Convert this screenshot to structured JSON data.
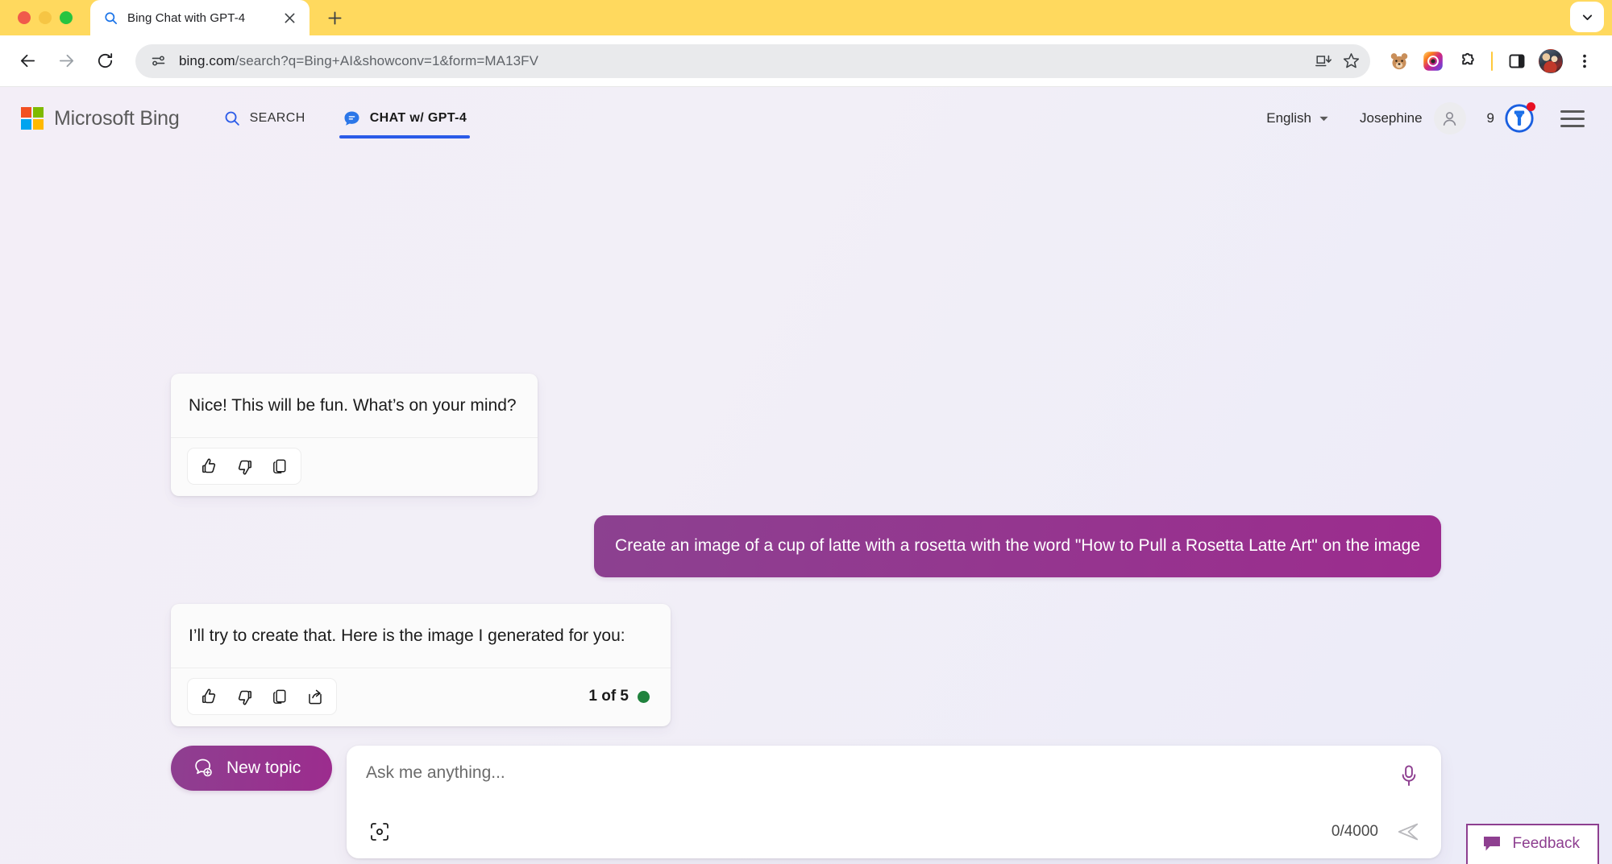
{
  "browser": {
    "window_controls": [
      "close",
      "minimize",
      "maximize"
    ],
    "tab": {
      "title": "Bing Chat with GPT-4",
      "favicon": "search-icon",
      "close_label": "×"
    },
    "new_tab_label": "+",
    "tab_list_chevron": "chevron-down-icon",
    "toolbar": {
      "back": "back-arrow-icon",
      "forward": "forward-arrow-icon",
      "reload": "reload-icon",
      "site_info": "page-settings-icon",
      "url_domain": "bing.com",
      "url_path": "/search?q=Bing+AI&showconv=1&form=MA13FV",
      "install_app": "install-icon",
      "bookmark": "star-icon",
      "extensions": [
        "bear-extension-icon",
        "camera-extension-icon",
        "puzzle-extension-icon"
      ],
      "side_panel": "side-panel-icon",
      "profile": "profile-avatar",
      "menu": "three-dot-menu-icon"
    }
  },
  "bing": {
    "logo_text": "Microsoft Bing",
    "nav": [
      {
        "label": "SEARCH",
        "icon": "magnifier-icon",
        "active": false
      },
      {
        "label": "CHAT w/ GPT-4",
        "icon": "chat-bubble-icon",
        "active": true
      }
    ],
    "language": "English",
    "user_name": "Josephine",
    "rewards_count": "9",
    "rewards_icon": "rewards-medal-icon",
    "menu_icon": "hamburger-menu-icon"
  },
  "chat": {
    "messages": [
      {
        "role": "bot",
        "text": "Nice! This will be fun. What’s on your mind?",
        "actions": [
          "thumbs-up-icon",
          "thumbs-down-icon",
          "copy-icon"
        ],
        "pager": null
      },
      {
        "role": "user",
        "text": "Create an image of a cup of latte with a rosetta with the word \"How to Pull a Rosetta Latte Art\" on the image"
      },
      {
        "role": "bot",
        "text": "I’ll try to create that. Here is the image I generated for you:",
        "actions": [
          "thumbs-up-icon",
          "thumbs-down-icon",
          "copy-icon",
          "share-icon"
        ],
        "pager": {
          "text": "1 of 5",
          "dot_color": "#20823D"
        }
      }
    ]
  },
  "composer": {
    "new_topic_label": "New topic",
    "new_topic_icon": "new-chat-icon",
    "input_placeholder": "Ask me anything...",
    "input_value": "",
    "visual_search_icon": "visual-search-icon",
    "char_count": "0/4000",
    "mic_icon": "microphone-icon",
    "send_icon": "send-icon"
  },
  "feedback": {
    "label": "Feedback",
    "icon": "feedback-bubble-icon"
  },
  "colors": {
    "tabstrip": "#FFD95E",
    "bing_accent_blue": "#2B5BE8",
    "user_bubble_purple_start": "#8C4190",
    "user_bubble_purple_end": "#9C2C8E",
    "status_green": "#20823D",
    "rewards_red": "#E81123"
  }
}
